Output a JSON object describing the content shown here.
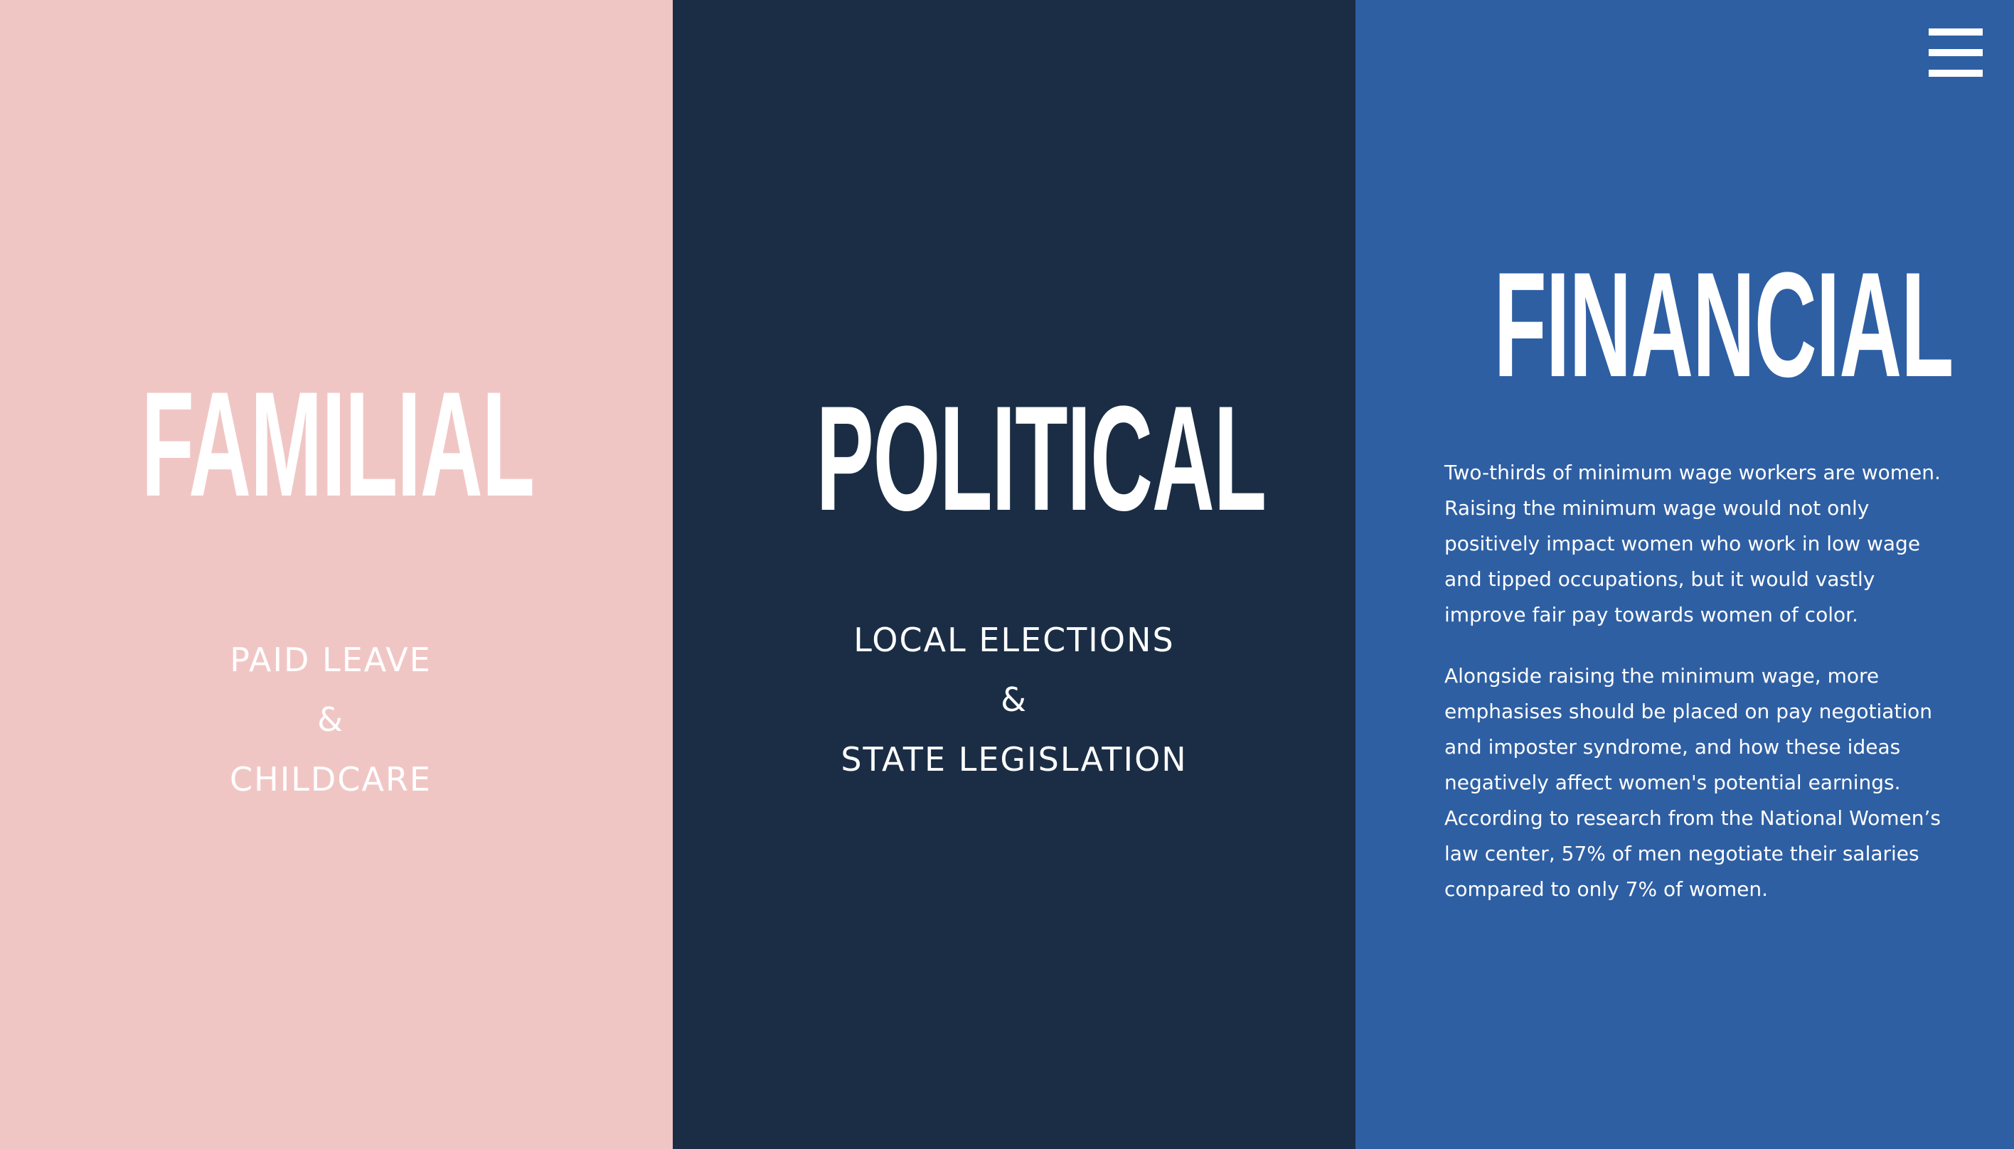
{
  "panels": {
    "familial": {
      "title": "FAMILIAL",
      "items": [
        "PAID LEAVE",
        "&",
        "CHILDCARE"
      ],
      "color": "#f0c6c5"
    },
    "political": {
      "title": "POLITICAL",
      "items": [
        "LOCAL ELECTIONS",
        "&",
        "STATE LEGISLATION"
      ],
      "color": "#1a2d45"
    },
    "financial": {
      "title": "FINANCIAL",
      "paragraphs": [
        "Two-thirds of minimum wage workers are women. Raising the minimum wage would not only positively impact women who work in low wage and tipped occupations, but it would vastly improve fair pay towards women of color.",
        "Alongside raising the minimum wage, more emphasises should be placed on pay negotiation and imposter syndrome, and how these ideas negatively affect women's potential earnings. According to research from the National Women’s law center, 57% of men negotiate their salaries compared to only 7% of women."
      ],
      "color": "#2e5fa3"
    }
  },
  "menu": {
    "icon": "hamburger-menu-icon"
  }
}
